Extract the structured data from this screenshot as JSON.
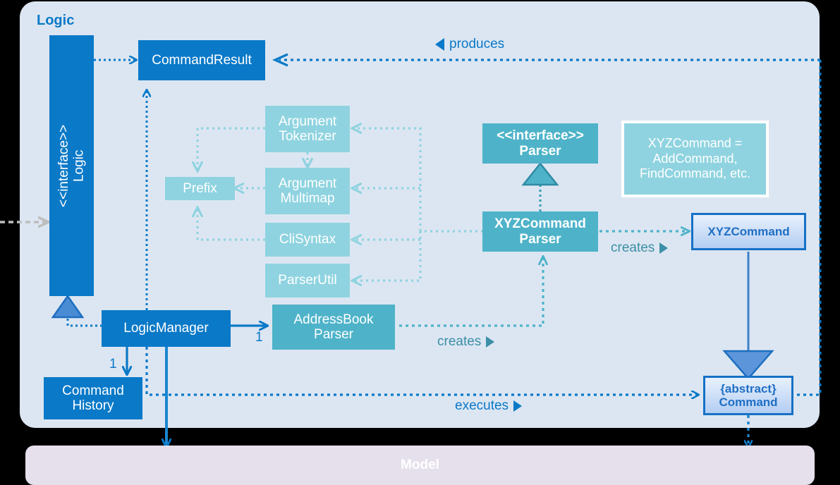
{
  "diagram": {
    "title": "Logic",
    "panels": {
      "logic_label": "Logic",
      "model_label": "Model"
    },
    "nodes": {
      "logic_interface": {
        "stereotype": "<<interface>>",
        "name": "Logic"
      },
      "command_result": {
        "name": "CommandResult"
      },
      "argument_tokenizer": {
        "line1": "Argument",
        "line2": "Tokenizer"
      },
      "argument_multimap": {
        "line1": "Argument",
        "line2": "Multimap"
      },
      "prefix": {
        "name": "Prefix"
      },
      "cli_syntax": {
        "name": "CliSyntax"
      },
      "parser_util": {
        "name": "ParserUtil"
      },
      "parser_interface": {
        "stereotype": "<<interface>>",
        "name": "Parser"
      },
      "xyz_command_parser": {
        "line1": "XYZCommand",
        "line2": "Parser"
      },
      "xyz_command": {
        "name": "XYZCommand"
      },
      "abstract_command": {
        "line1": "{abstract}",
        "line2": "Command"
      },
      "logic_manager": {
        "name": "LogicManager"
      },
      "address_book_parser": {
        "line1": "AddressBook",
        "line2": "Parser"
      },
      "command_history": {
        "line1": "Command",
        "line2": "History"
      }
    },
    "note": {
      "line1": "XYZCommand =",
      "line2": "AddCommand,",
      "line3": "FindCommand, etc."
    },
    "edge_labels": {
      "produces": "produces",
      "creates_parser": "creates",
      "creates_abp": "creates",
      "executes": "executes"
    },
    "multiplicities": {
      "abp": "1",
      "history": "1"
    },
    "colors": {
      "panel_bg": "#dce6f2",
      "dark_blue": "#0a79c8",
      "teal": "#4eb3c9",
      "light_cyan": "#8fd3e0",
      "model_bg": "#e6e0ec",
      "grad_border": "#1571c6",
      "grad_text": "#1f6fc4",
      "gray_arrow": "#bdbdbd"
    }
  }
}
